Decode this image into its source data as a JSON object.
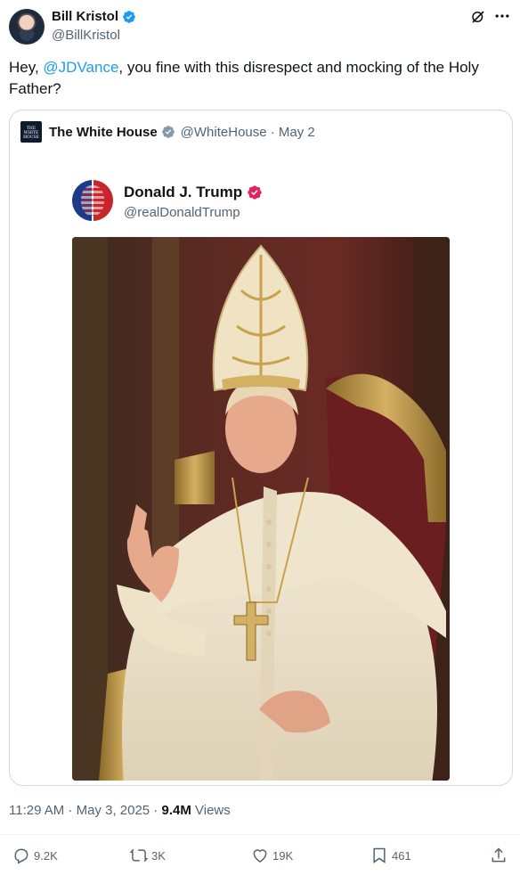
{
  "author": {
    "display_name": "Bill Kristol",
    "handle": "@BillKristol"
  },
  "tweet": {
    "text_prefix": "Hey, ",
    "mention": "@JDVance",
    "text_suffix": ", you fine with this disrespect and mocking of the Holy Father?"
  },
  "quote": {
    "logo_text": "THE WHITE HOUSE",
    "author_name": "The White House",
    "handle_date": "@WhiteHouse · May 2",
    "embedded_name": "Donald J. Trump",
    "embedded_handle": "@realDonaldTrump"
  },
  "meta": {
    "time_date": "11:29 AM · May 3, 2025 · ",
    "views_count": "9.4M",
    "views_label": " Views"
  },
  "actions": {
    "replies": "9.2K",
    "reposts": "3K",
    "likes": "19K",
    "bookmarks": "461"
  },
  "colors": {
    "accent": "#1d9bf0",
    "muted": "#536471",
    "verified_blue": "#1d9bf0",
    "verified_gray": "#829aab",
    "verified_pink": "#e0245e"
  }
}
